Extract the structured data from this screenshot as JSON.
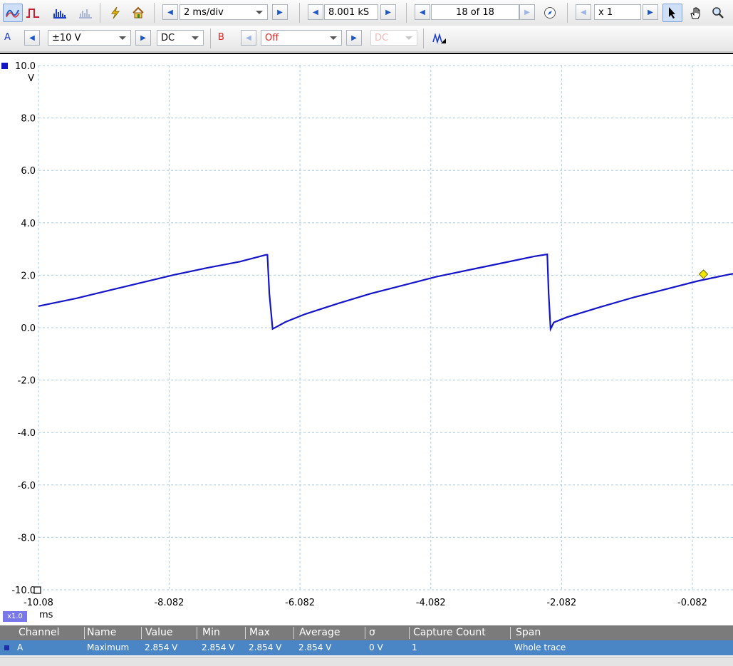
{
  "toolbar_top": {
    "timebase": "2 ms/div",
    "samples": "8.001 kS",
    "buffer": "18 of 18",
    "zoom": "x 1",
    "icons": [
      "scope-mode-icon",
      "persistence-mode-icon",
      "spectrum-mode-icon",
      "spectrum-disabled-icon",
      "lightning-icon",
      "home-icon",
      "compass-icon",
      "pointer-icon",
      "hand-icon",
      "magnify-icon"
    ]
  },
  "toolbar_channels": {
    "channel_a_label": "A",
    "channel_a_range": "±10 V",
    "channel_a_coupling": "DC",
    "channel_b_label": "B",
    "channel_b_range": "Off",
    "channel_b_coupling": "DC",
    "math_icon": "math-channel-icon"
  },
  "chart_data": {
    "type": "line",
    "xlabel": "ms",
    "ylabel": "V",
    "xlim": [
      -10.08,
      0.92
    ],
    "ylim": [
      -10.0,
      10.0
    ],
    "grid": true,
    "y_ticks": [
      "10.0",
      "8.0",
      "6.0",
      "4.0",
      "2.0",
      "0.0",
      "-2.0",
      "-4.0",
      "-6.0",
      "-8.0",
      "-10.0"
    ],
    "x_ticks": [
      "-10.08",
      "-8.082",
      "-6.082",
      "-4.082",
      "-2.082",
      "-0.082"
    ],
    "x_tick_values": [
      -10.08,
      -8.082,
      -6.082,
      -4.082,
      -2.082,
      -0.082
    ],
    "y_tick_values": [
      10,
      8,
      6,
      4,
      2,
      0,
      -2,
      -4,
      -6,
      -8,
      -10
    ],
    "zoom_label": "x1.0",
    "trace_color": "#1515c8",
    "series": [
      {
        "name": "A",
        "x": [
          -10.08,
          -9.5,
          -9.0,
          -8.5,
          -8.0,
          -7.5,
          -7.0,
          -6.6,
          -6.58,
          -6.55,
          -6.5,
          -6.3,
          -6.0,
          -5.5,
          -5.0,
          -4.5,
          -4.0,
          -3.5,
          -3.0,
          -2.5,
          -2.3,
          -2.28,
          -2.25,
          -2.2,
          -2.0,
          -1.5,
          -1.0,
          -0.5,
          0.0,
          0.5,
          0.92
        ],
        "y": [
          0.82,
          1.12,
          1.42,
          1.72,
          2.02,
          2.28,
          2.52,
          2.78,
          2.78,
          1.3,
          -0.05,
          0.22,
          0.52,
          0.92,
          1.3,
          1.62,
          1.94,
          2.2,
          2.46,
          2.72,
          2.8,
          1.3,
          -0.05,
          0.2,
          0.4,
          0.78,
          1.14,
          1.46,
          1.78,
          2.04,
          2.2
        ]
      }
    ],
    "ruler_marker": {
      "x": 0.0,
      "y": 2.04,
      "color": "#f2e600"
    }
  },
  "measurements": {
    "headers": [
      "Channel",
      "Name",
      "Value",
      "Min",
      "Max",
      "Average",
      "σ",
      "Capture Count",
      "Span"
    ],
    "rows": [
      [
        "A",
        "Maximum",
        "2.854 V",
        "2.854 V",
        "2.854 V",
        "2.854 V",
        "0 V",
        "1",
        "Whole trace"
      ]
    ]
  }
}
